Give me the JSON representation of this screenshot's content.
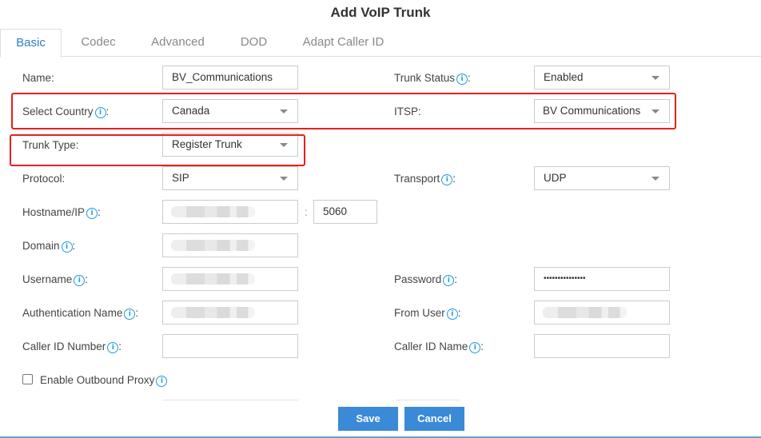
{
  "dialog": {
    "title": "Add VoIP Trunk"
  },
  "tabs": [
    {
      "label": "Basic",
      "active": true
    },
    {
      "label": "Codec",
      "active": false
    },
    {
      "label": "Advanced",
      "active": false
    },
    {
      "label": "DOD",
      "active": false
    },
    {
      "label": "Adapt Caller ID",
      "active": false
    }
  ],
  "icons": {
    "info": "info-circle-icon",
    "caret": "caret-down-icon"
  },
  "form": {
    "name": {
      "label": "Name:",
      "value": "BV_Communications"
    },
    "trunk_status": {
      "label": "Trunk Status",
      "suffix": ":",
      "value": "Enabled"
    },
    "select_country": {
      "label": "Select Country",
      "suffix": ":",
      "value": "Canada"
    },
    "itsp": {
      "label": "ITSP:",
      "value": "BV Communications"
    },
    "trunk_type": {
      "label": "Trunk Type:",
      "value": "Register Trunk"
    },
    "protocol": {
      "label": "Protocol:",
      "value": "SIP"
    },
    "transport": {
      "label": "Transport",
      "suffix": ":",
      "value": "UDP"
    },
    "hostname": {
      "label": "Hostname/IP",
      "suffix": ":",
      "value": "",
      "port_separator": ":",
      "port": "5060"
    },
    "domain": {
      "label": "Domain",
      "suffix": ":",
      "value": ""
    },
    "username": {
      "label": "Username",
      "suffix": ":",
      "value": ""
    },
    "password": {
      "label": "Password",
      "suffix": ":",
      "value": "•••••••••••••••"
    },
    "auth_name": {
      "label": "Authentication Name",
      "suffix": ":",
      "value": ""
    },
    "from_user": {
      "label": "From User",
      "suffix": ":",
      "value": ""
    },
    "caller_id_number": {
      "label": "Caller ID Number",
      "suffix": ":",
      "value": ""
    },
    "caller_id_name": {
      "label": "Caller ID Name",
      "suffix": ":",
      "value": ""
    },
    "outbound_proxy": {
      "label": "Enable Outbound Proxy",
      "checked": false
    }
  },
  "buttons": {
    "save": "Save",
    "cancel": "Cancel"
  },
  "colors": {
    "accent": "#3a8ad8",
    "tab_active": "#2f7fc1",
    "info": "#1e9be0",
    "highlight": "#e8201a"
  }
}
